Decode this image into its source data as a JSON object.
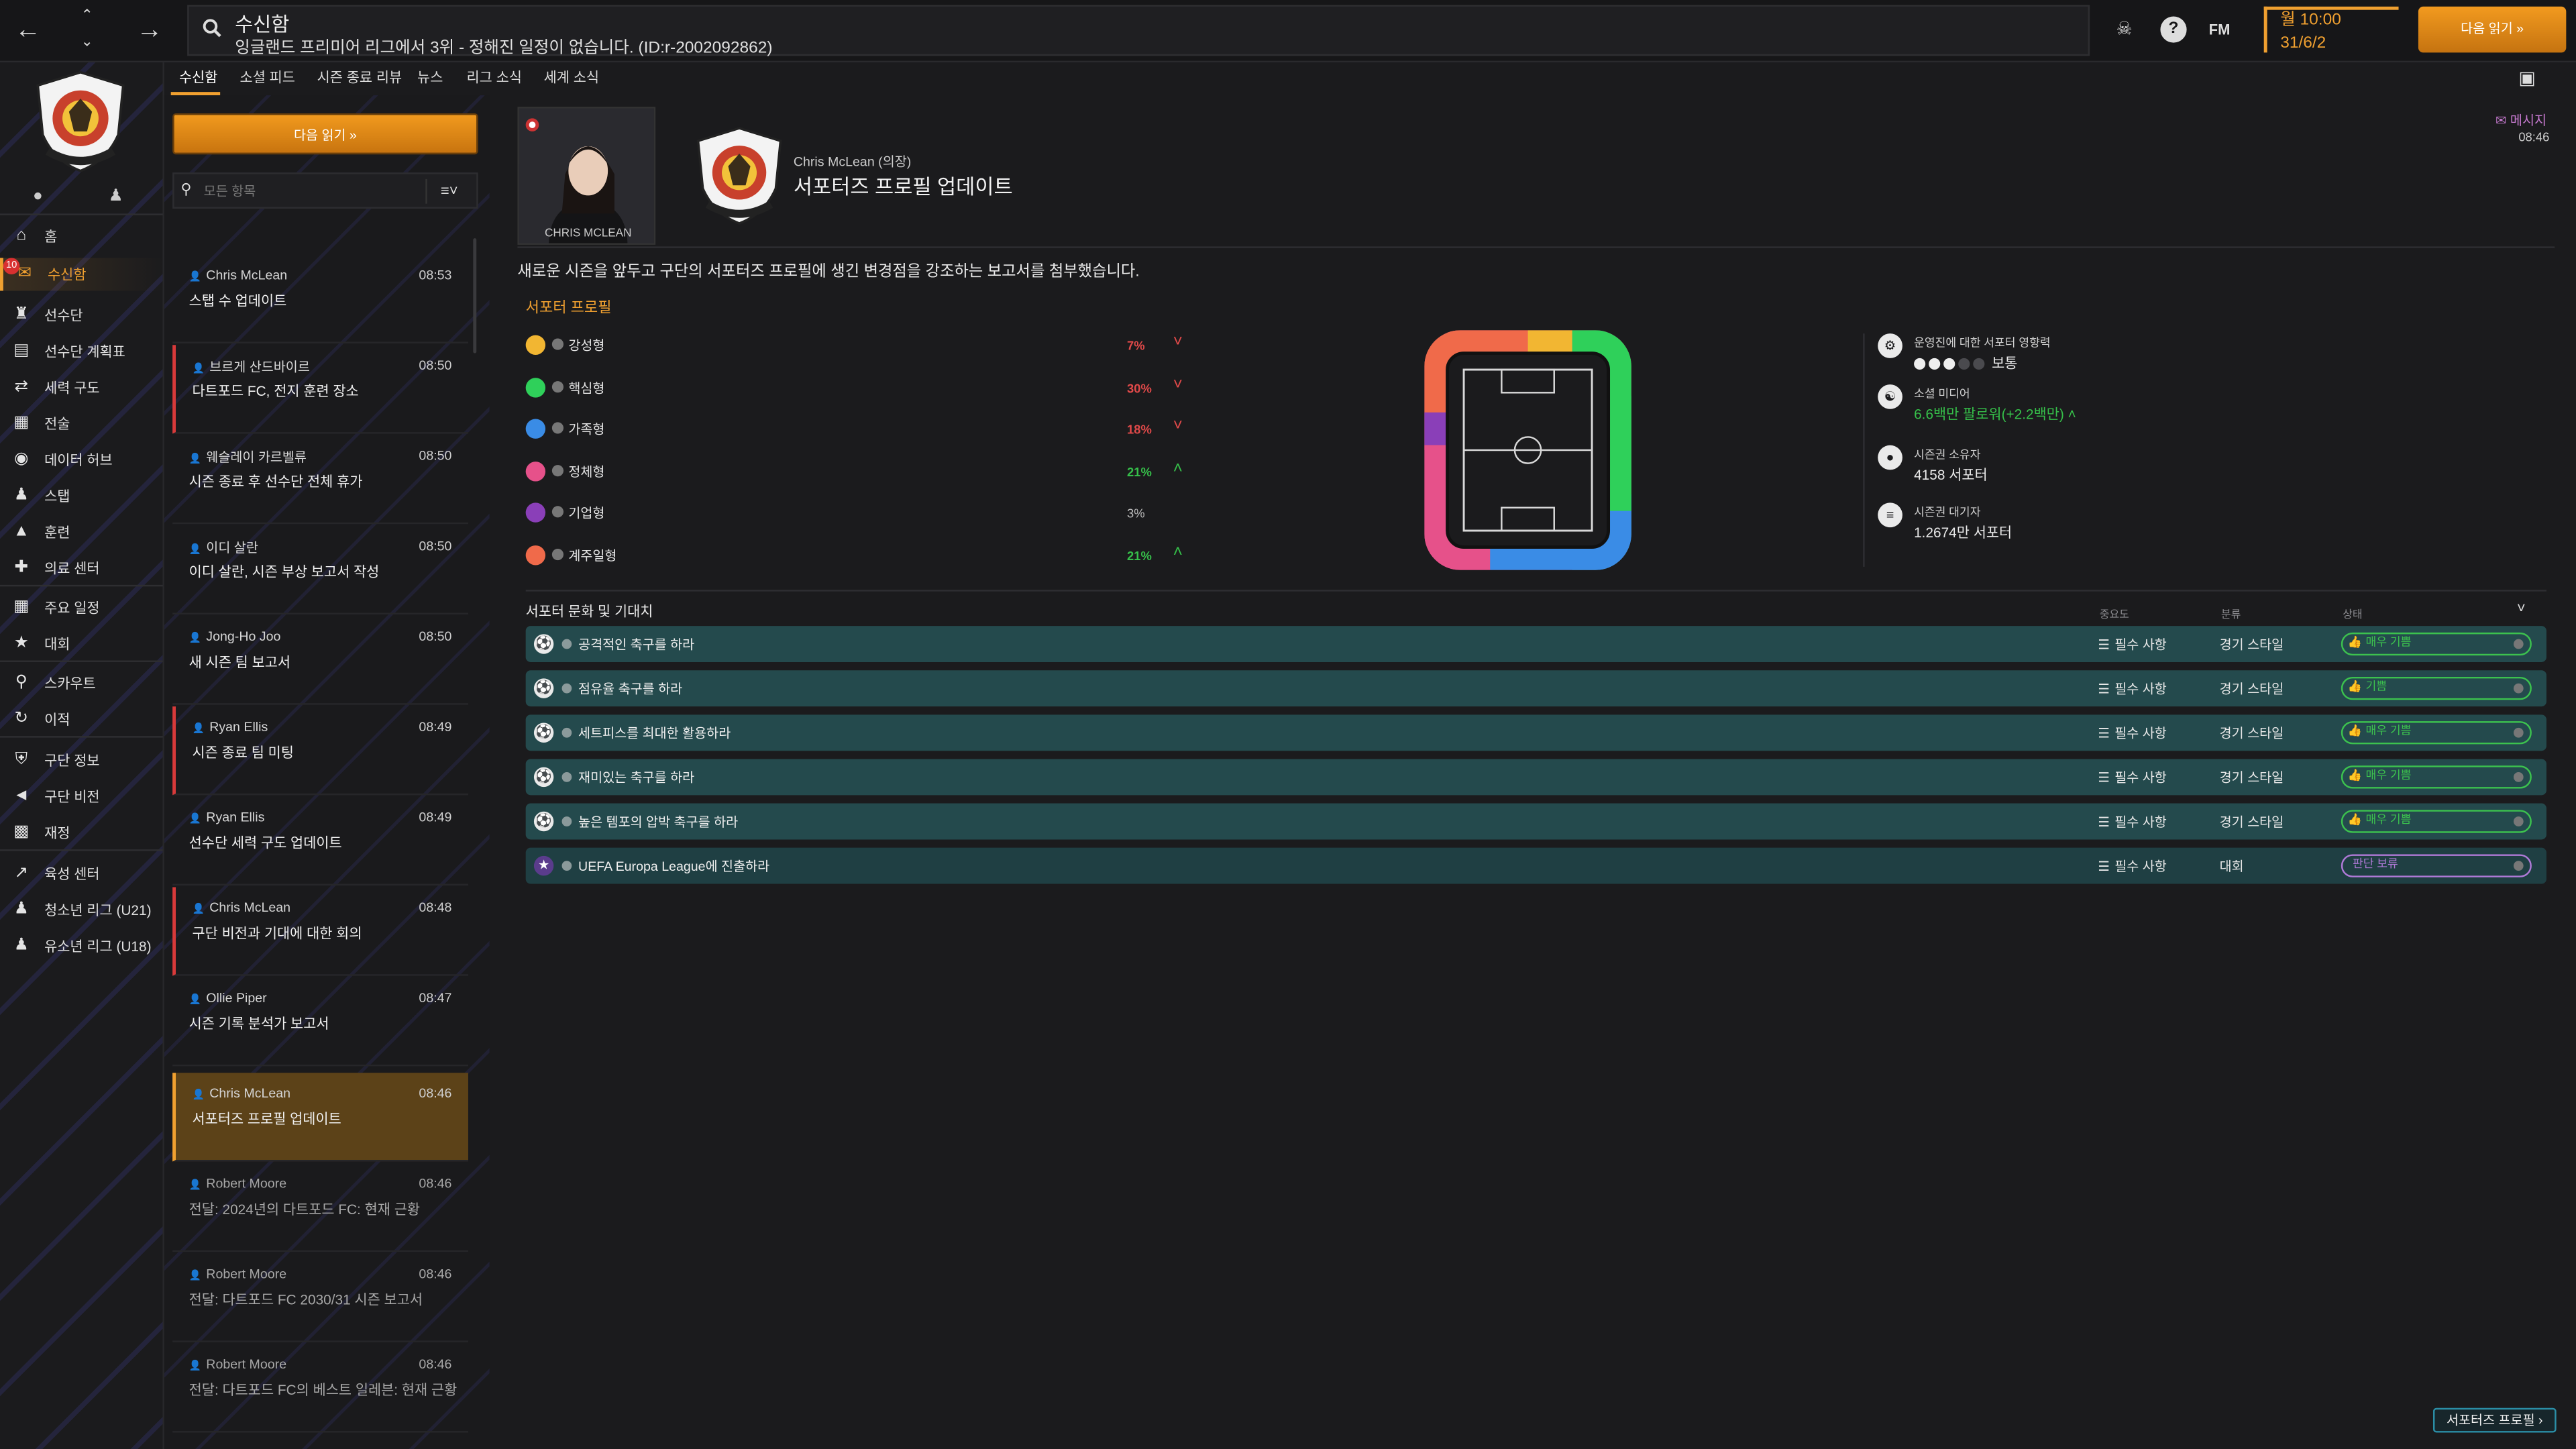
{
  "topbar": {
    "title": "수신함",
    "subtitle": "잉글랜드 프리미어 리그에서 3위 - 정해진 일정이 없습니다. (ID:r-2002092862)",
    "fm_label": "FM",
    "time": "월 10:00",
    "date": "31/6/2",
    "continue_label": "다음 읽기 »"
  },
  "sidebar": {
    "badge_count": "10",
    "items": [
      {
        "label": "홈",
        "icon": "home-icon"
      },
      {
        "label": "수신함",
        "icon": "inbox-icon"
      },
      {
        "label": "선수단",
        "icon": "shirt-icon"
      },
      {
        "label": "선수단 계획표",
        "icon": "clipboard-icon"
      },
      {
        "label": "세력 구도",
        "icon": "arrows-icon"
      },
      {
        "label": "전술",
        "icon": "tactics-icon"
      },
      {
        "label": "데이터 허브",
        "icon": "data-hub-icon"
      },
      {
        "label": "스탭",
        "icon": "staff-icon"
      },
      {
        "label": "훈련",
        "icon": "training-icon"
      },
      {
        "label": "의료 센터",
        "icon": "medical-icon"
      },
      {
        "label": "주요 일정",
        "icon": "calendar-icon"
      },
      {
        "label": "대회",
        "icon": "trophy-icon"
      },
      {
        "label": "스카우트",
        "icon": "scout-icon"
      },
      {
        "label": "이적",
        "icon": "transfer-icon"
      },
      {
        "label": "구단 정보",
        "icon": "club-info-icon"
      },
      {
        "label": "구단 비전",
        "icon": "vision-icon"
      },
      {
        "label": "재정",
        "icon": "finance-icon"
      },
      {
        "label": "육성 센터",
        "icon": "development-icon"
      },
      {
        "label": "청소년 리그 (U21)",
        "icon": "youth-icon"
      },
      {
        "label": "유소년 리그 (U18)",
        "icon": "youth-icon"
      }
    ]
  },
  "tabs": [
    "수신함",
    "소셜 피드",
    "시즌 종료 리뷰",
    "뉴스",
    "리그 소식",
    "세계 소식"
  ],
  "inbox": {
    "continue_label": "다음 읽기 »",
    "search_placeholder": "모든 항목",
    "messages": [
      {
        "from": "Chris McLean",
        "time": "08:53",
        "subject": "스탭 수 업데이트"
      },
      {
        "from": "브르게 산드바이르",
        "time": "08:50",
        "subject": "다트포드 FC, 전지 훈련 장소"
      },
      {
        "from": "웨슬레이 카르벨류",
        "time": "08:50",
        "subject": "시즌 종료 후 선수단 전체 휴가"
      },
      {
        "from": "이디 살란",
        "time": "08:50",
        "subject": "이디 살란, 시즌 부상 보고서 작성"
      },
      {
        "from": "Jong-Ho Joo",
        "time": "08:50",
        "subject": "새 시즌 팀 보고서"
      },
      {
        "from": "Ryan Ellis",
        "time": "08:49",
        "subject": "시즌 종료 팀 미팅"
      },
      {
        "from": "Ryan Ellis",
        "time": "08:49",
        "subject": "선수단 세력 구도 업데이트"
      },
      {
        "from": "Chris McLean",
        "time": "08:48",
        "subject": "구단 비전과 기대에 대한 회의"
      },
      {
        "from": "Ollie Piper",
        "time": "08:47",
        "subject": "시즌 기록 분석가 보고서"
      },
      {
        "from": "Chris McLean",
        "time": "08:46",
        "subject": "서포터즈 프로필 업데이트"
      },
      {
        "from": "Robert Moore",
        "time": "08:46",
        "subject": "전달: 2024년의 다트포드 FC: 현재 근황"
      },
      {
        "from": "Robert Moore",
        "time": "08:46",
        "subject": "전달: 다트포드 FC 2030/31 시즌 보고서"
      },
      {
        "from": "Robert Moore",
        "time": "08:46",
        "subject": "전달: 다트포드 FC의 베스트 일레븐: 현재 근황"
      }
    ]
  },
  "message": {
    "portrait_name": "CHRIS MCLEAN",
    "sender": "Chris McLean (의장)",
    "title": "서포터즈 프로필 업데이트",
    "msg_label": "메시지",
    "msg_time": "08:46",
    "intro": "새로운 시즌을 앞두고 구단의 서포터즈 프로필에 생긴 변경점을 강조하는 보고서를 첨부했습니다.",
    "section_title": "서포터 프로필",
    "segments": [
      {
        "label": "강성형",
        "pct": "7%",
        "trend": "down",
        "color": "#f2b632"
      },
      {
        "label": "핵심형",
        "pct": "30%",
        "trend": "down",
        "color": "#2fd05a"
      },
      {
        "label": "가족형",
        "pct": "18%",
        "trend": "down",
        "color": "#3a8ce6"
      },
      {
        "label": "정체형",
        "pct": "21%",
        "trend": "up",
        "color": "#e6518a"
      },
      {
        "label": "기업형",
        "pct": "3%",
        "trend": "none",
        "color": "#8a3fb8"
      },
      {
        "label": "계주일형",
        "pct": "21%",
        "trend": "up",
        "color": "#f06a4a"
      }
    ],
    "stats": {
      "influence_label": "운영진에 대한 서포터 영향력",
      "influence_value": "보통",
      "influence_level": 3,
      "social_label": "소셜 미디어",
      "social_value": "6.6백만 팔로워(+2.2백만)",
      "season_label": "시즌권 소유자",
      "season_value": "4158 서포터",
      "wait_label": "시즌권 대기자",
      "wait_value": "1.2674만 서포터"
    },
    "expectations_title": "서포터 문화 및 기대치",
    "col_importance": "중요도",
    "col_category": "분류",
    "col_status": "상태",
    "expectations": [
      {
        "text": "공격적인 축구를 하라",
        "importance": "필수 사항",
        "category": "경기 스타일",
        "status": "매우 기쁨",
        "kind": "ok"
      },
      {
        "text": "점유율 축구를 하라",
        "importance": "필수 사항",
        "category": "경기 스타일",
        "status": "기쁨",
        "kind": "ok"
      },
      {
        "text": "세트피스를 최대한 활용하라",
        "importance": "필수 사항",
        "category": "경기 스타일",
        "status": "매우 기쁨",
        "kind": "ok"
      },
      {
        "text": "재미있는 축구를 하라",
        "importance": "필수 사항",
        "category": "경기 스타일",
        "status": "매우 기쁨",
        "kind": "ok"
      },
      {
        "text": "높은 템포의 압박 축구를 하라",
        "importance": "필수 사항",
        "category": "경기 스타일",
        "status": "매우 기쁨",
        "kind": "ok"
      },
      {
        "text": "UEFA Europa League에 진출하라",
        "importance": "필수 사항",
        "category": "대회",
        "status": "판단 보류",
        "kind": "pend"
      }
    ],
    "profile_button": "서포터즈 프로필 ›"
  },
  "colors": {
    "accent": "#f0a030",
    "positive": "#36c04a",
    "negative": "#e34a4a",
    "pending": "#b07ad8"
  }
}
